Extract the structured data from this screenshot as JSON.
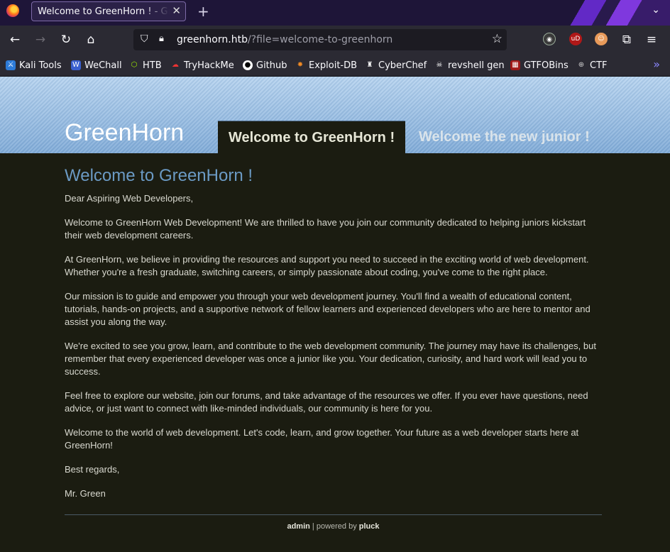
{
  "browser": {
    "tab_title": "Welcome to GreenHorn ! - GreenHorn",
    "url_host": "greenhorn.htb",
    "url_path": "/?file=welcome-to-greenhorn",
    "bookmarks": [
      "Kali Tools",
      "WeChall",
      "HTB",
      "TryHackMe",
      "Github",
      "Exploit-DB",
      "CyberChef",
      "revshell gen",
      "GTFOBins",
      "CTF"
    ]
  },
  "site": {
    "title": "GreenHorn",
    "menu": [
      "Welcome to GreenHorn !",
      "Welcome the new junior !"
    ]
  },
  "main": {
    "title": "Welcome to GreenHorn !",
    "paragraphs": [
      "Dear Aspiring Web Developers,",
      "Welcome to GreenHorn Web Development! We are thrilled to have you join our community dedicated to helping juniors kickstart their web development careers.",
      "At GreenHorn, we believe in providing the resources and support you need to succeed in the exciting world of web development. Whether you're a fresh graduate, switching careers, or simply passionate about coding, you've come to the right place.",
      "Our mission is to guide and empower you through your web development journey. You'll find a wealth of educational content, tutorials, hands-on projects, and a supportive network of fellow learners and experienced developers who are here to mentor and assist you along the way.",
      "We're excited to see you grow, learn, and contribute to the web development community. The journey may have its challenges, but remember that every experienced developer was once a junior like you. Your dedication, curiosity, and hard work will lead you to success.",
      "Feel free to explore our website, join our forums, and take advantage of the resources we offer. If you ever have questions, need advice, or just want to connect with like-minded individuals, our community is here for you.",
      "Welcome to the world of web development. Let's code, learn, and grow together. Your future as a web developer starts here at GreenHorn!",
      "Best regards,",
      "Mr. Green"
    ]
  },
  "footer": {
    "admin": "admin",
    "separator": " | powered by ",
    "pluck": "pluck"
  }
}
